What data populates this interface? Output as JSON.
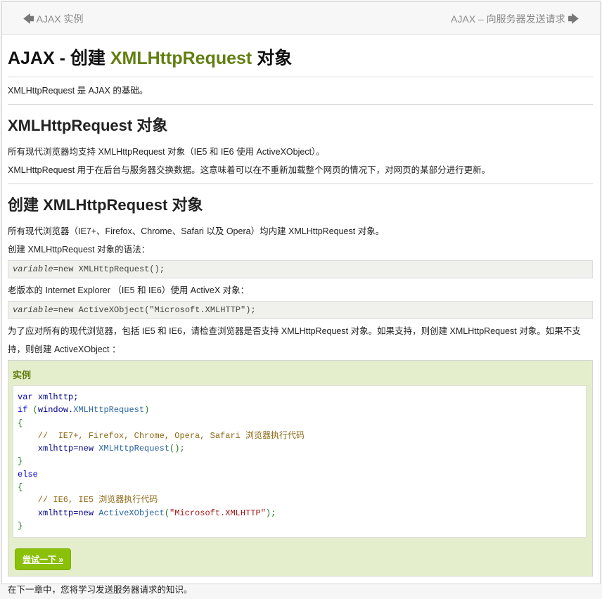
{
  "nav": {
    "prev_label": "AJAX 实例",
    "next_label": "AJAX – 向服务器发送请求"
  },
  "title": {
    "prefix": "AJAX - 创建 ",
    "highlight": "XMLHttpRequest",
    "suffix": " 对象"
  },
  "intro": "XMLHttpRequest 是 AJAX 的基础。",
  "section1": {
    "heading": "XMLHttpRequest 对象",
    "p1": "所有现代浏览器均支持 XMLHttpRequest 对象（IE5 和 IE6 使用 ActiveXObject）。",
    "p2": "XMLHttpRequest 用于在后台与服务器交换数据。这意味着可以在不重新加载整个网页的情况下，对网页的某部分进行更新。"
  },
  "section2": {
    "heading": "创建 XMLHttpRequest 对象",
    "p1": "所有现代浏览器（IE7+、Firefox、Chrome、Safari 以及 Opera）均内建 XMLHttpRequest 对象。",
    "p2": "创建 XMLHttpRequest 对象的语法：",
    "code1_var": "variable",
    "code1_rest": "=new XMLHttpRequest();",
    "p3": "老版本的 Internet Explorer （IE5 和 IE6）使用 ActiveX 对象：",
    "code2_var": "variable",
    "code2_rest": "=new ActiveXObject(\"Microsoft.XMLHTTP\");",
    "p4": "为了应对所有的现代浏览器，包括 IE5 和 IE6，请检查浏览器是否支持 XMLHttpRequest 对象。如果支持，则创建 XMLHttpRequest 对象。如果不支持，则创建 ActiveXObject ："
  },
  "example": {
    "heading": "实例",
    "button": "尝试一下 »",
    "lines": {
      "l1a": "var ",
      "l1b": "xmlhttp;",
      "l2a": "if ",
      "l2b": "(",
      "l2c": "window.",
      "l2d": "XMLHttpRequest",
      "l2e": ")",
      "l3": "{",
      "l4": "    //  IE7+, Firefox, Chrome, Opera, Safari 浏览器执行代码",
      "l5a": "    xmlhttp=new ",
      "l5b": "XMLHttpRequest",
      "l5c": "();",
      "l6": "}",
      "l7": "else",
      "l8": "{",
      "l9": "    // IE6, IE5 浏览器执行代码",
      "l10a": "    xmlhttp=new ",
      "l10b": "ActiveXObject",
      "l10c": "(",
      "l10d": "\"Microsoft.XMLHTTP\"",
      "l10e": ");",
      "l11": "}"
    }
  },
  "footer_text": "在下一章中，您将学习发送服务器请求的知识。"
}
